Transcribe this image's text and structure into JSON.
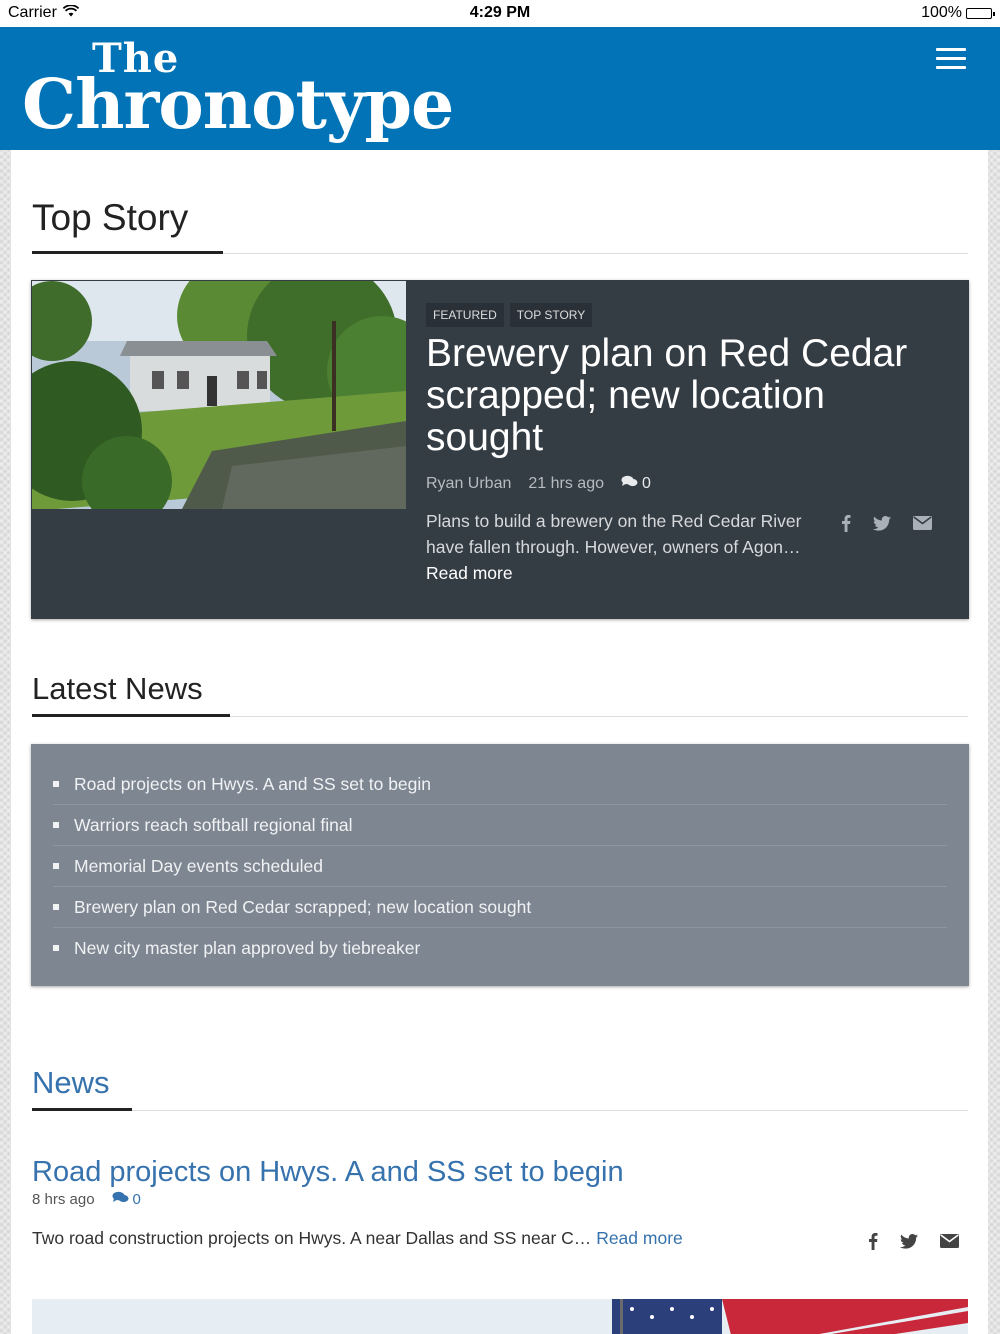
{
  "status_bar": {
    "carrier": "Carrier",
    "time": "4:29 PM",
    "battery": "100%"
  },
  "header": {
    "logo_top": "The",
    "logo_main": "Chronotype"
  },
  "top_story": {
    "section_title": "Top Story",
    "tags": [
      "FEATURED",
      "TOP STORY"
    ],
    "title": "Brewery plan on Red Cedar scrapped; new location sought",
    "author": "Ryan Urban",
    "time": "21 hrs ago",
    "comments": "0",
    "excerpt": "Plans to build a brewery on the Red Cedar River have fallen through. However, owners of Agon…",
    "read_more": "Read more"
  },
  "latest_news": {
    "section_title": "Latest News",
    "items": [
      "Road projects on Hwys. A and SS set to begin",
      "Warriors reach softball regional final",
      "Memorial Day events scheduled",
      "Brewery plan on Red Cedar scrapped; new location sought",
      "New city master plan approved by tiebreaker"
    ]
  },
  "news": {
    "section_title": "News",
    "articles": [
      {
        "title": "Road projects on Hwys. A and SS set to begin",
        "time": "8 hrs ago",
        "comments": "0",
        "excerpt": "Two road construction projects on Hwys. A near Dallas and SS near C…",
        "read_more": "Read more"
      }
    ]
  },
  "colors": {
    "brand": "#0173b6",
    "card_dark": "#343c44",
    "latest_box": "#7d8691",
    "link": "#3672ad"
  }
}
